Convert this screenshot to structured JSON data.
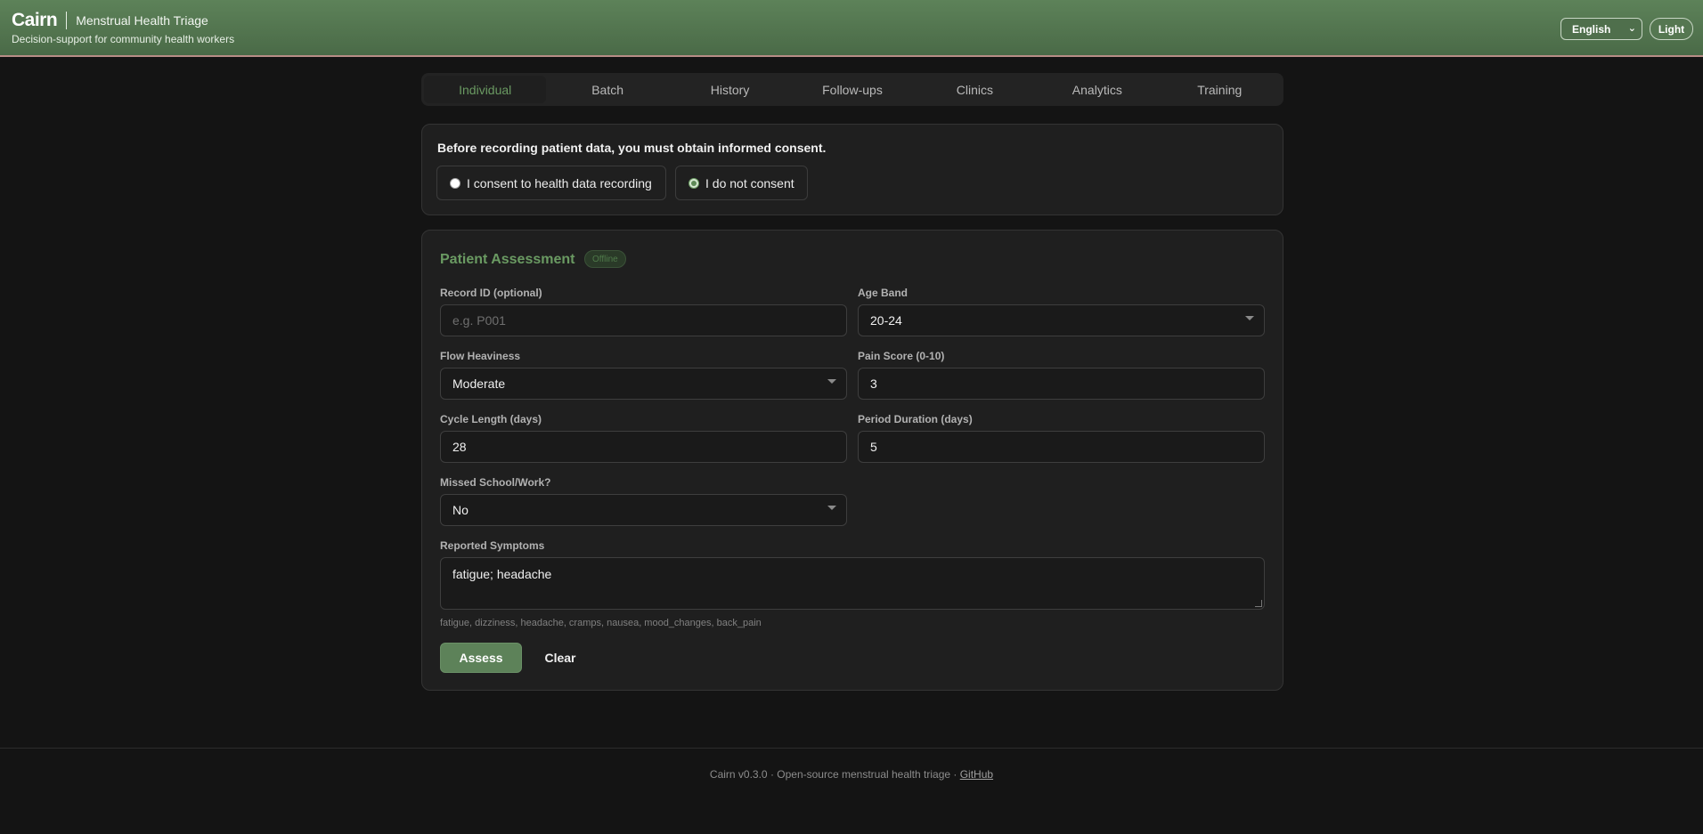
{
  "header": {
    "brand": "Cairn",
    "app_title": "Menstrual Health Triage",
    "tagline": "Decision-support for community health workers",
    "language": "English",
    "theme_label": "Light",
    "accent": "#5d8259"
  },
  "tabs": [
    {
      "label": "Individual",
      "active": true
    },
    {
      "label": "Batch",
      "active": false
    },
    {
      "label": "History",
      "active": false
    },
    {
      "label": "Follow-ups",
      "active": false
    },
    {
      "label": "Clinics",
      "active": false
    },
    {
      "label": "Analytics",
      "active": false
    },
    {
      "label": "Training",
      "active": false
    }
  ],
  "consent": {
    "prompt": "Before recording patient data, you must obtain informed consent.",
    "options": [
      {
        "label": "I consent to health data recording",
        "selected": false
      },
      {
        "label": "I do not consent",
        "selected": true
      }
    ]
  },
  "assessment": {
    "title": "Patient Assessment",
    "status_badge": "Offline",
    "record_id": {
      "label": "Record ID (optional)",
      "value": "",
      "placeholder": "e.g. P001"
    },
    "age_band": {
      "label": "Age Band",
      "value": "20-24"
    },
    "flow": {
      "label": "Flow Heaviness",
      "value": "Moderate"
    },
    "pain": {
      "label": "Pain Score (0-10)",
      "value": "3"
    },
    "cycle": {
      "label": "Cycle Length (days)",
      "value": "28"
    },
    "duration": {
      "label": "Period Duration (days)",
      "value": "5"
    },
    "missed": {
      "label": "Missed School/Work?",
      "value": "No"
    },
    "symptoms": {
      "label": "Reported Symptoms",
      "value": "fatigue; headache",
      "hint": "fatigue, dizziness, headache, cramps, nausea, mood_changes, back_pain"
    },
    "assess_label": "Assess",
    "clear_label": "Clear"
  },
  "footer": {
    "text": "Cairn v0.3.0 · Open-source menstrual health triage · ",
    "link": "GitHub"
  }
}
